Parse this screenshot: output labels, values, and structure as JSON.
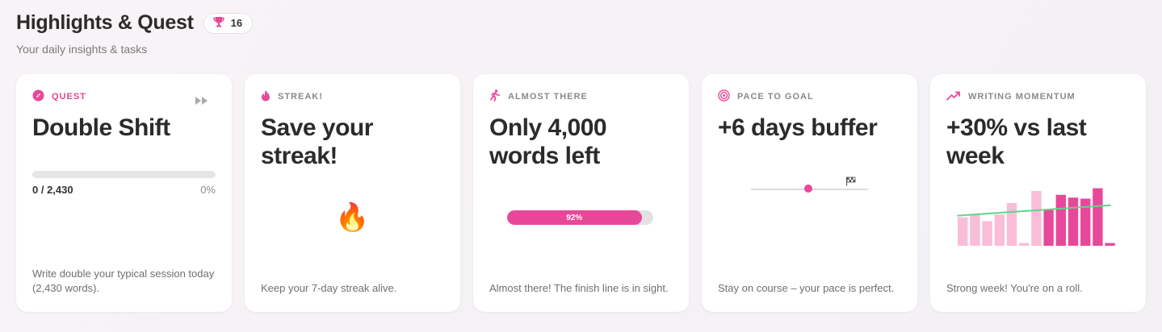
{
  "header": {
    "title": "Highlights & Quest",
    "trophy_count": "16",
    "subtitle": "Your daily insights & tasks"
  },
  "colors": {
    "accent": "#e8489a",
    "trend_line": "#5dd68a"
  },
  "cards": [
    {
      "label": "QUEST",
      "icon": "compass-icon",
      "headline": "Double Shift",
      "progress_count": "0 / 2,430",
      "progress_percent": "0%",
      "progress_value": 0,
      "footer": "Write double your typical session today (2,430 words)."
    },
    {
      "label": "STREAK!",
      "icon": "flame-icon",
      "headline": "Save your streak!",
      "emoji": "🔥",
      "footer": "Keep your 7-day streak alive."
    },
    {
      "label": "ALMOST THERE",
      "icon": "runner-icon",
      "headline": "Only 4,000 words left",
      "progress_label": "92%",
      "progress_value": 0.92,
      "footer": "Almost there! The finish line is in sight."
    },
    {
      "label": "PACE TO GOAL",
      "icon": "target-icon",
      "headline": "+6 days buffer",
      "pace_position": 0.49,
      "goal_position": 0.82,
      "footer": "Stay on course – your pace is perfect."
    },
    {
      "label": "WRITING MOMENTUM",
      "icon": "trend-up-icon",
      "headline": "+30% vs last week",
      "footer": "Strong week! You're on a roll."
    }
  ],
  "chart_data": {
    "type": "bar",
    "series": [
      {
        "values": [
          0.52,
          0.57,
          0.45,
          0.57,
          0.78,
          0.05,
          1.0,
          0.66,
          0.93,
          0.88,
          0.86,
          1.05,
          0.05
        ]
      }
    ],
    "series_colors": [
      "#f9bdd8",
      "#f9bdd8",
      "#f9bdd8",
      "#f9bdd8",
      "#f9bdd8",
      "#f9bdd8",
      "#f9bdd8",
      "#e8489a",
      "#e8489a",
      "#e8489a",
      "#e8489a",
      "#e8489a",
      "#e8489a"
    ],
    "trend": [
      0.55,
      0.74
    ],
    "grid": false,
    "legend": "none"
  }
}
